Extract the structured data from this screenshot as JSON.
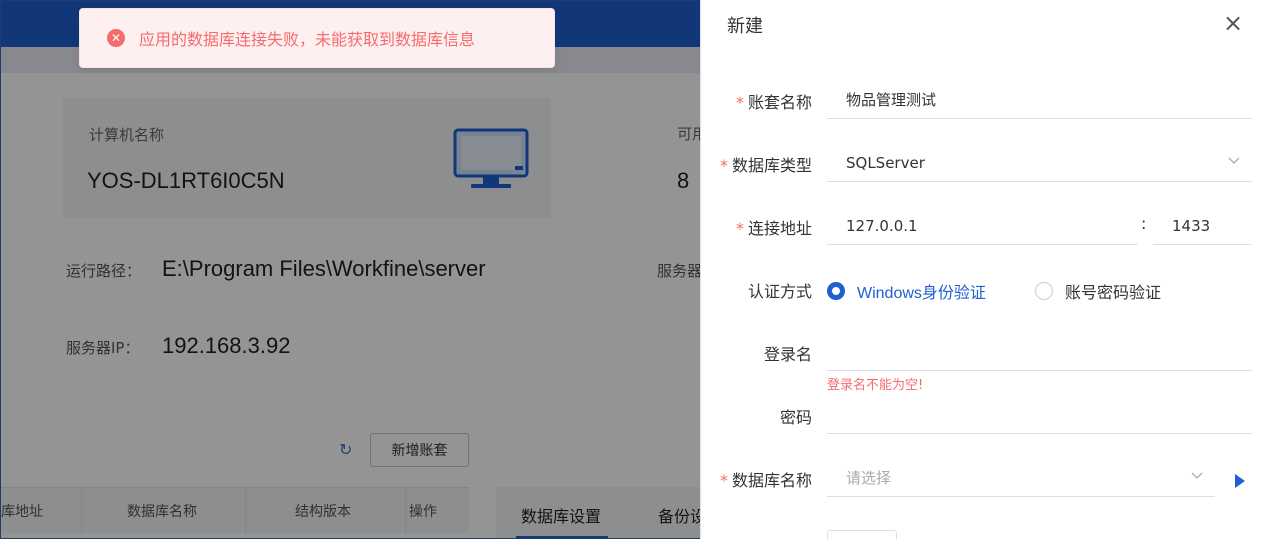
{
  "toast": {
    "message": "应用的数据库连接失败，未能获取到数据库信息",
    "icon": "error-icon"
  },
  "background": {
    "computer_name_label": "计算机名称",
    "computer_name": "YOS-DL1RT6I0C5N",
    "available_label": "可用",
    "available_value": "8",
    "run_path_label": "运行路径：",
    "run_path": "E:\\Program Files\\Workfine\\server",
    "server_label_partial": "服务器",
    "server_ip_label": "服务器IP：",
    "server_ip": "192.168.3.92",
    "add_account_button": "新增账套",
    "table_headers": [
      "库地址",
      "数据库名称",
      "结构版本",
      "操作"
    ],
    "tabs": [
      "数据库设置",
      "备份设"
    ]
  },
  "drawer": {
    "title": "新建",
    "fields": {
      "account_name": {
        "label": "账套名称",
        "value": "物品管理测试",
        "required": true
      },
      "db_type": {
        "label": "数据库类型",
        "value": "SQLServer",
        "required": true
      },
      "address": {
        "label": "连接地址",
        "host": "127.0.0.1",
        "separator": ":",
        "port": "1433",
        "required": true
      },
      "auth": {
        "label": "认证方式",
        "options": [
          "Windows身份验证",
          "账号密码验证"
        ],
        "selected": "Windows身份验证"
      },
      "login": {
        "label": "登录名",
        "value": "",
        "error": "登录名不能为空!"
      },
      "password": {
        "label": "密码",
        "value": ""
      },
      "db_name": {
        "label": "数据库名称",
        "placeholder": "请选择",
        "required": true
      }
    },
    "required_mark": "*"
  },
  "colors": {
    "primary": "#1f5fd0",
    "error": "#f56c6c"
  }
}
